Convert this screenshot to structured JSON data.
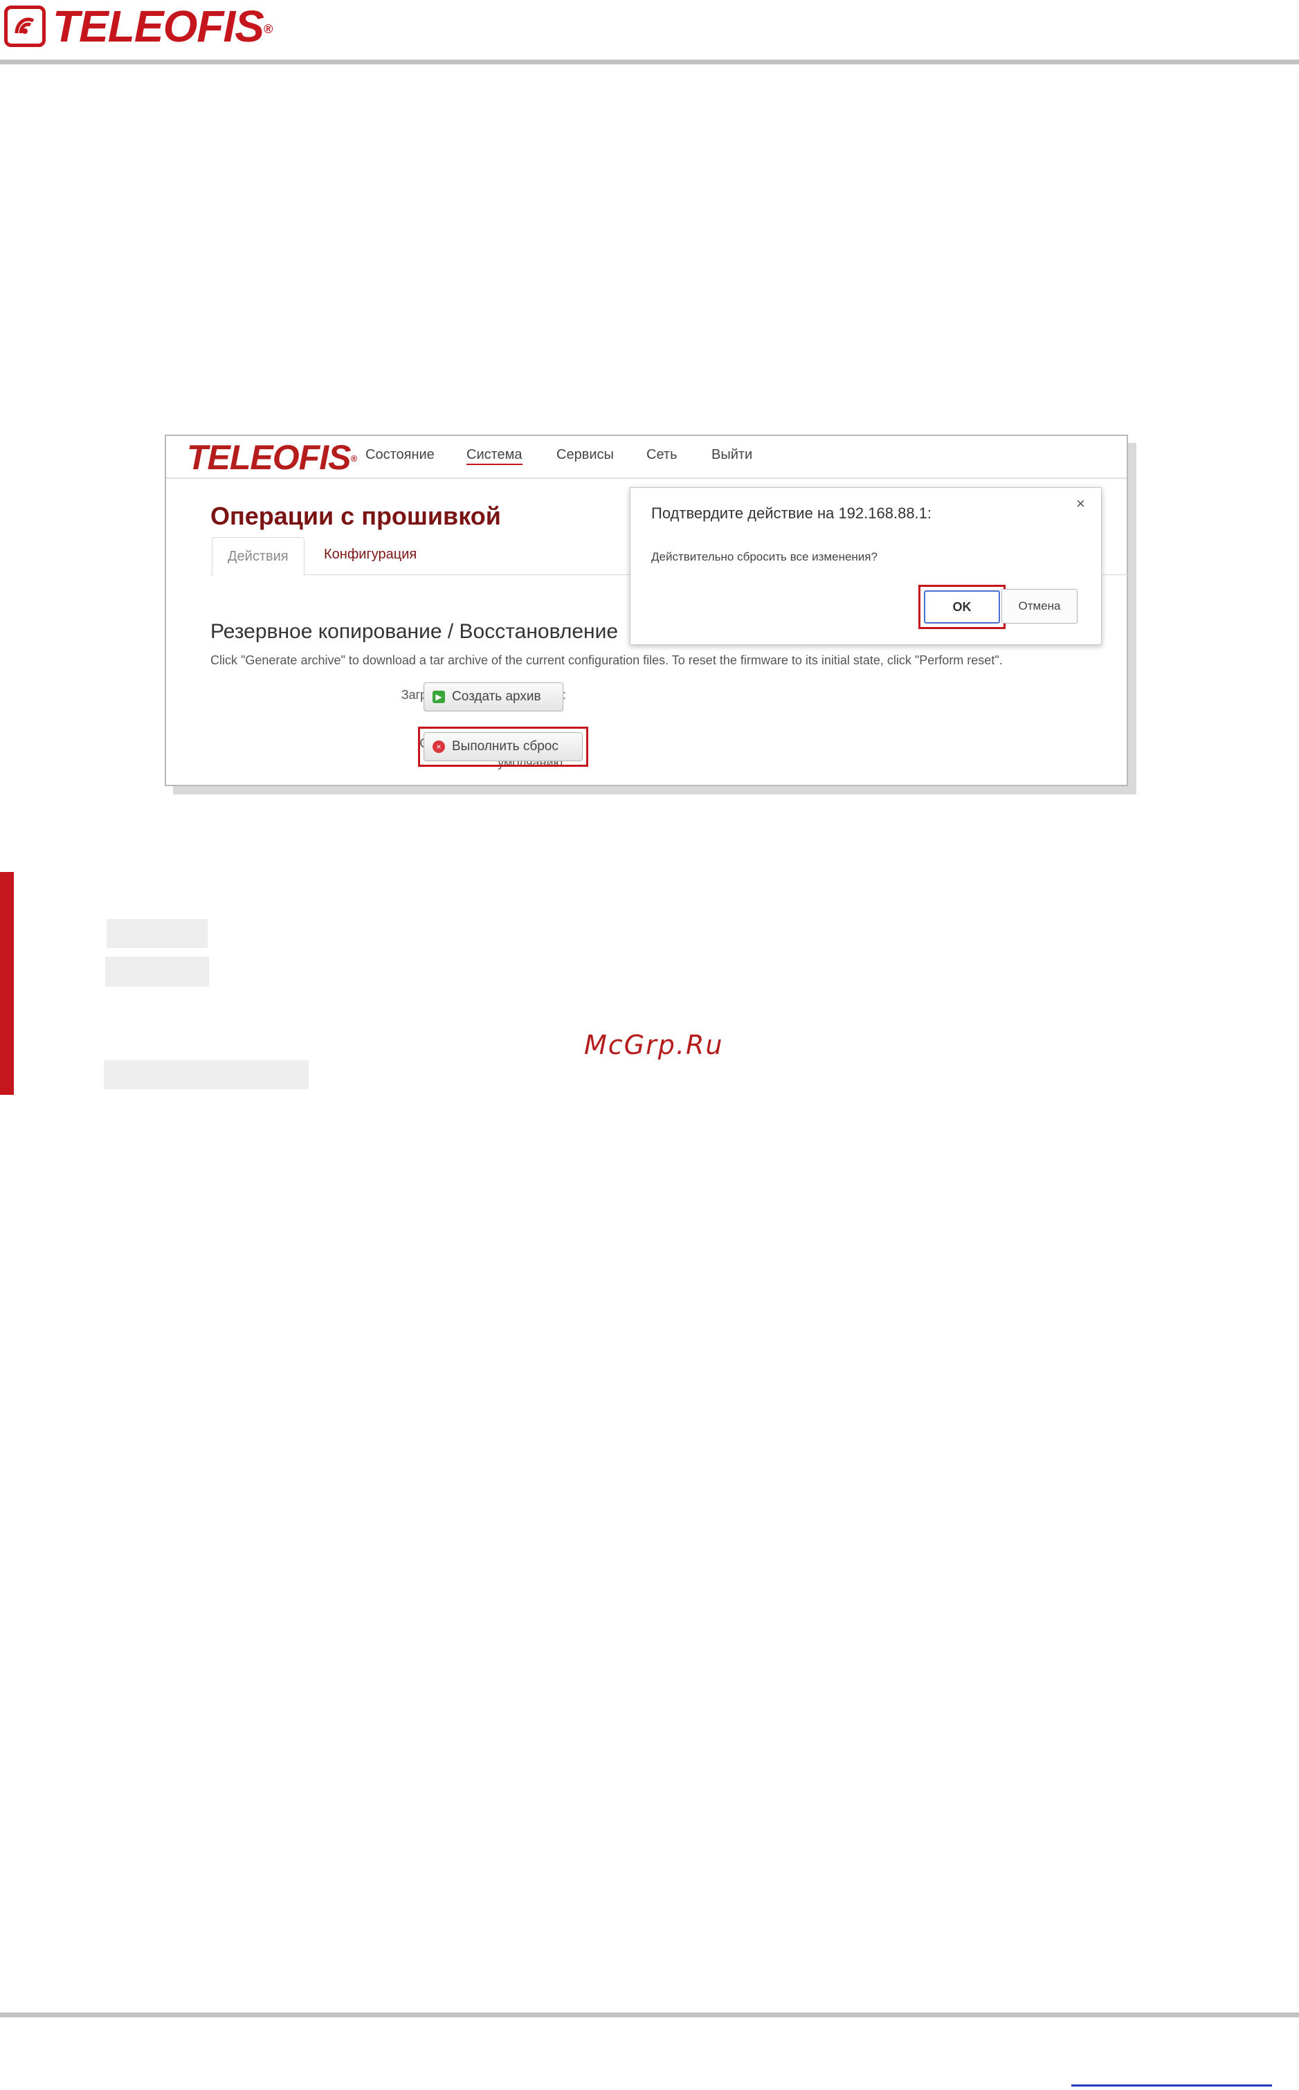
{
  "document": {
    "brand": "TELEOFIS",
    "brand_mark": "®",
    "watermark": "McGrp.Ru"
  },
  "screenshot": {
    "nav": {
      "logo": "TELEOFIS",
      "logo_mark": "®",
      "items": [
        "Состояние",
        "Система",
        "Сервисы",
        "Сеть",
        "Выйти"
      ],
      "active_item": "Система"
    },
    "page_title": "Операции с прошивкой",
    "tabs": [
      "Действия",
      "Конфигурация"
    ],
    "section_title": "Резервное копирование / Восстановление",
    "description": "Click \"Generate archive\" to download a tar archive of the current configuration files. To reset the firmware to its initial state, click \"Perform reset\".",
    "backup_label": "Загрузить резервную копию:",
    "backup_button": "Создать архив",
    "reset_label_line1": "Сбросить на значения по",
    "reset_label_line2": "умолчанию:",
    "reset_button": "Выполнить сброс",
    "dialog": {
      "title": "Подтвердите действие на 192.168.88.1:",
      "message": "Действительно сбросить все изменения?",
      "ok": "OK",
      "cancel": "Отмена",
      "close": "×"
    },
    "colors": {
      "brand_red": "#c4161c",
      "title_red": "#7a1414",
      "backup_icon": "#3aa53a",
      "reset_icon": "#d9363e"
    }
  }
}
